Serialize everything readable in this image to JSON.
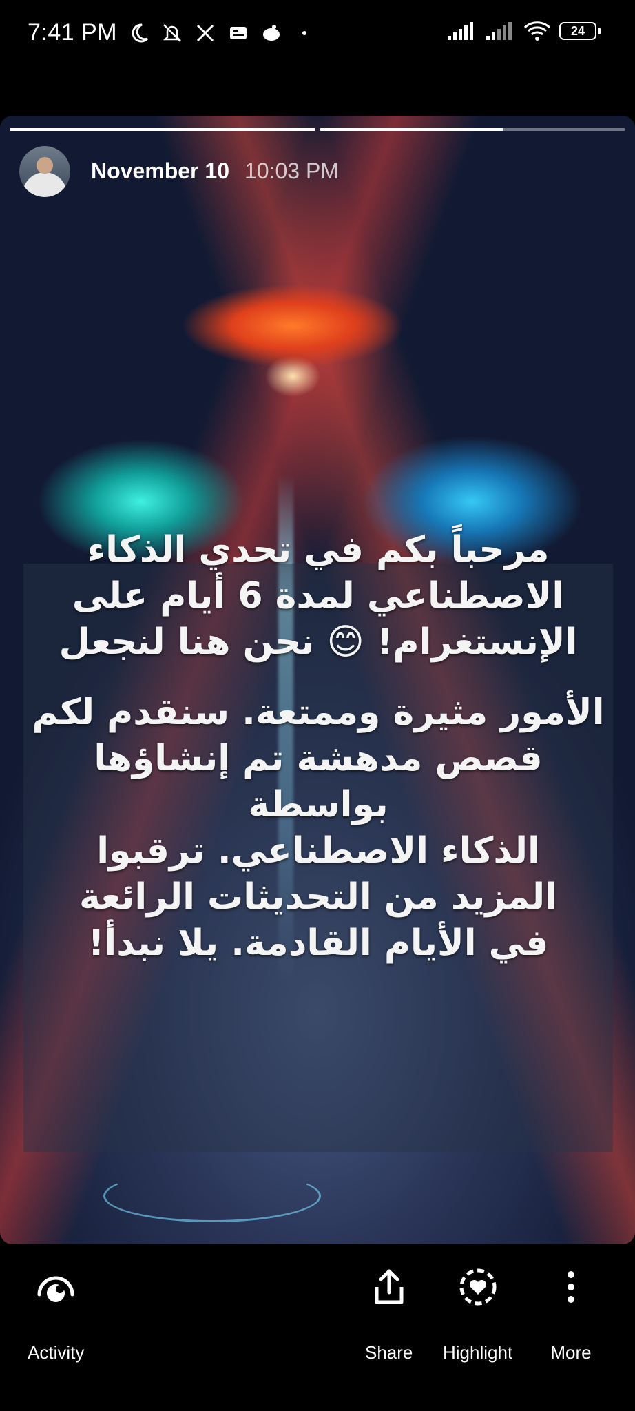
{
  "status_bar": {
    "time": "7:41 PM",
    "battery_level": "24",
    "icons": [
      "moon-icon",
      "silent-mode-icon",
      "x-logo-icon",
      "sim-card-icon",
      "notification-app-icon",
      "dot-icon",
      "signal-strength-icon",
      "signal-strength-2-icon",
      "wifi-icon",
      "battery-icon"
    ]
  },
  "story": {
    "progress_segments": [
      1.0,
      0.6
    ],
    "header": {
      "date": "November 10",
      "time": "10:03 PM"
    },
    "message": {
      "paragraph1": [
        "مرحباً بكم في تحدي الذكاء",
        "الاصطناعي لمدة 6 أيام على",
        "الإنستغرام! 😊 نحن هنا لنجعل"
      ],
      "paragraph2": [
        "الأمور مثيرة وممتعة. سنقدم لكم",
        "قصص مدهشة تم إنشاؤها بواسطة",
        "الذكاء الاصطناعي. ترقبوا",
        "المزيد من التحديثات الرائعة",
        "في الأيام القادمة. يلا نبدأ!"
      ]
    }
  },
  "actions": {
    "activity": "Activity",
    "share": "Share",
    "highlight": "Highlight",
    "more": "More"
  }
}
